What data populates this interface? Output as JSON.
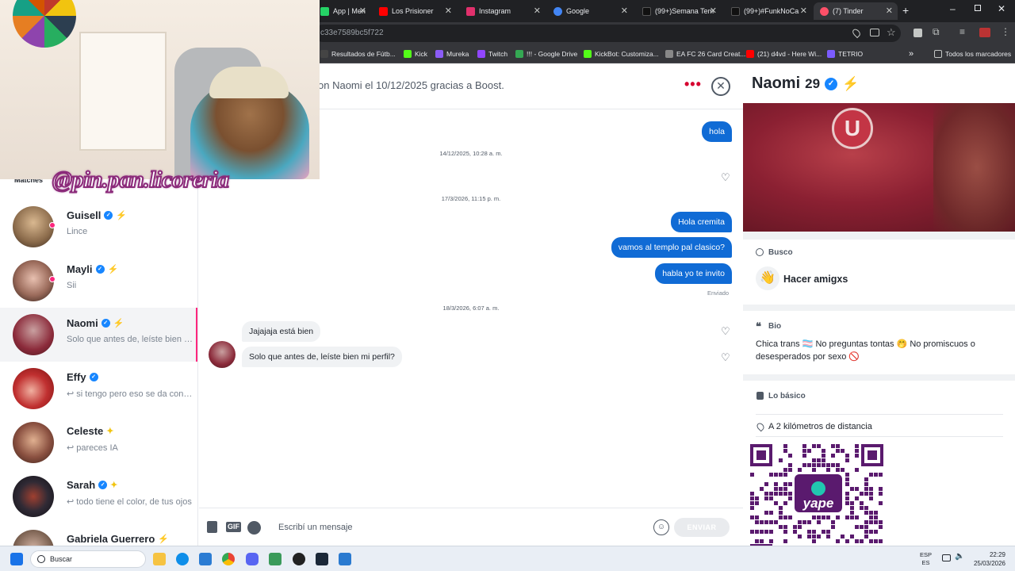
{
  "browser": {
    "tabs": [
      {
        "label": "App | Men",
        "color": "#25d366"
      },
      {
        "label": "Los Prisioner",
        "color": "#ff0000"
      },
      {
        "label": "Instagram",
        "color": "#e1306c"
      },
      {
        "label": "Google",
        "color": "#4285f4"
      },
      {
        "label": "(99+)Semana Tem",
        "color": "#000000"
      },
      {
        "label": "(99+)#FunkNoCa",
        "color": "#000000"
      },
      {
        "label": "(7) Tinder",
        "color": "#fd5068"
      }
    ],
    "url": "c33e7589bc5f722",
    "bookmarks": [
      {
        "label": "Resultados de Fútb...",
        "color": "#444444"
      },
      {
        "label": "Kick",
        "color": "#53fc18"
      },
      {
        "label": "Mureka",
        "color": "#8b5cf6"
      },
      {
        "label": "Twitch",
        "color": "#9146ff"
      },
      {
        "label": "!!! - Google Drive",
        "color": "#34a853"
      },
      {
        "label": "KickBot: Customiza...",
        "color": "#53fc18"
      },
      {
        "label": "EA FC 26 Card Creat...",
        "color": "#888888"
      },
      {
        "label": "(21) d4vd - Here Wi...",
        "color": "#ff0000"
      },
      {
        "label": "TETRIO",
        "color": "#7b5cff"
      }
    ],
    "all_bookmarks": "Todos los marcadores"
  },
  "overlay": {
    "handle": "@pin.pan.licoreria"
  },
  "sidebar": {
    "header": "Matches",
    "items": [
      {
        "name": "Guisell",
        "preview": "Lince",
        "verified": true,
        "bolt": "purple",
        "unread": true,
        "avatar": "#8a6a4a"
      },
      {
        "name": "Mayli",
        "preview": "Sii",
        "verified": true,
        "bolt": "purple",
        "unread": true,
        "avatar": "#5a3a2a"
      },
      {
        "name": "Naomi",
        "preview": "Solo que antes de, leíste bien mi perfil?",
        "verified": true,
        "bolt": "purple",
        "unread": false,
        "avatar": "#8b2a3a"
      },
      {
        "name": "Effy",
        "preview": "↩ si tengo pero eso se da conforme",
        "verified": true,
        "bolt": "",
        "unread": false,
        "avatar": "#c03030"
      },
      {
        "name": "Celeste",
        "preview": "↩ pareces IA",
        "verified": false,
        "bolt": "gold",
        "unread": false,
        "avatar": "#6a4030"
      },
      {
        "name": "Sarah",
        "preview": "↩ todo tiene el color, de tus ojos",
        "verified": true,
        "bolt": "gold",
        "unread": false,
        "avatar": "#302a35"
      },
      {
        "name": "Gabriela Guerrero",
        "preview": "",
        "verified": false,
        "bolt": "purple",
        "unread": false,
        "avatar": "#7a6050"
      }
    ]
  },
  "chat": {
    "header": "on Naomi el 10/12/2025 gracias a Boost.",
    "messages": [
      {
        "type": "out",
        "text": "hola"
      },
      {
        "type": "time",
        "text": "14/12/2025, 10:28 a. m."
      },
      {
        "type": "time",
        "text": "17/3/2026, 11:15 p. m."
      },
      {
        "type": "out",
        "text": "Hola cremita"
      },
      {
        "type": "out",
        "text": "vamos al templo pal clasico?"
      },
      {
        "type": "out",
        "text": "habla yo te invito"
      },
      {
        "type": "sent",
        "text": "Enviado"
      },
      {
        "type": "time",
        "text": "18/3/2026, 6:07 a. m."
      },
      {
        "type": "in",
        "text": "Jajajaja está bien"
      },
      {
        "type": "in",
        "text": "Solo que antes de, leíste bien mi perfil?"
      }
    ],
    "composer": {
      "placeholder": "Escribí un mensaje",
      "gif": "GIF",
      "send": "ENVIAR"
    }
  },
  "profile": {
    "name": "Naomi",
    "age": "29",
    "looking_for_label": "Busco",
    "looking_for_value": "Hacer amigxs",
    "bio_label": "Bio",
    "bio": "Chica trans 🏳️‍⚧️ No preguntas tontas 🤭 No promiscuos o desesperados por sexo 🚫",
    "basics_label": "Lo básico",
    "distance": "A 2 kilómetros de distancia",
    "qr_text": "yape"
  },
  "taskbar": {
    "search": "Buscar",
    "lang": "ESP",
    "lang2": "ES",
    "time": "22:29",
    "date": "25/03/2026"
  }
}
